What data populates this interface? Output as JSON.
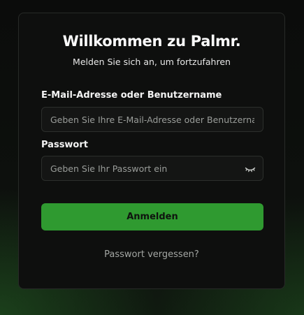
{
  "login": {
    "title": "Willkommen zu Palmr.",
    "subtitle": "Melden Sie sich an, um fortzufahren",
    "email_label": "E-Mail-Adresse oder Benutzername",
    "email_placeholder": "Geben Sie Ihre E-Mail-Adresse oder Benutzername ein",
    "email_value": "",
    "password_label": "Passwort",
    "password_placeholder": "Geben Sie Ihr Passwort ein",
    "password_value": "",
    "password_toggle_icon": "eye-closed-icon",
    "submit_label": "Anmelden",
    "forgot_password_label": "Passwort vergessen?"
  },
  "colors": {
    "accent": "#2f9a30",
    "card_background": "#0e0f0e",
    "page_background": "#0b0c0b",
    "muted_text": "#a3a6a3"
  }
}
